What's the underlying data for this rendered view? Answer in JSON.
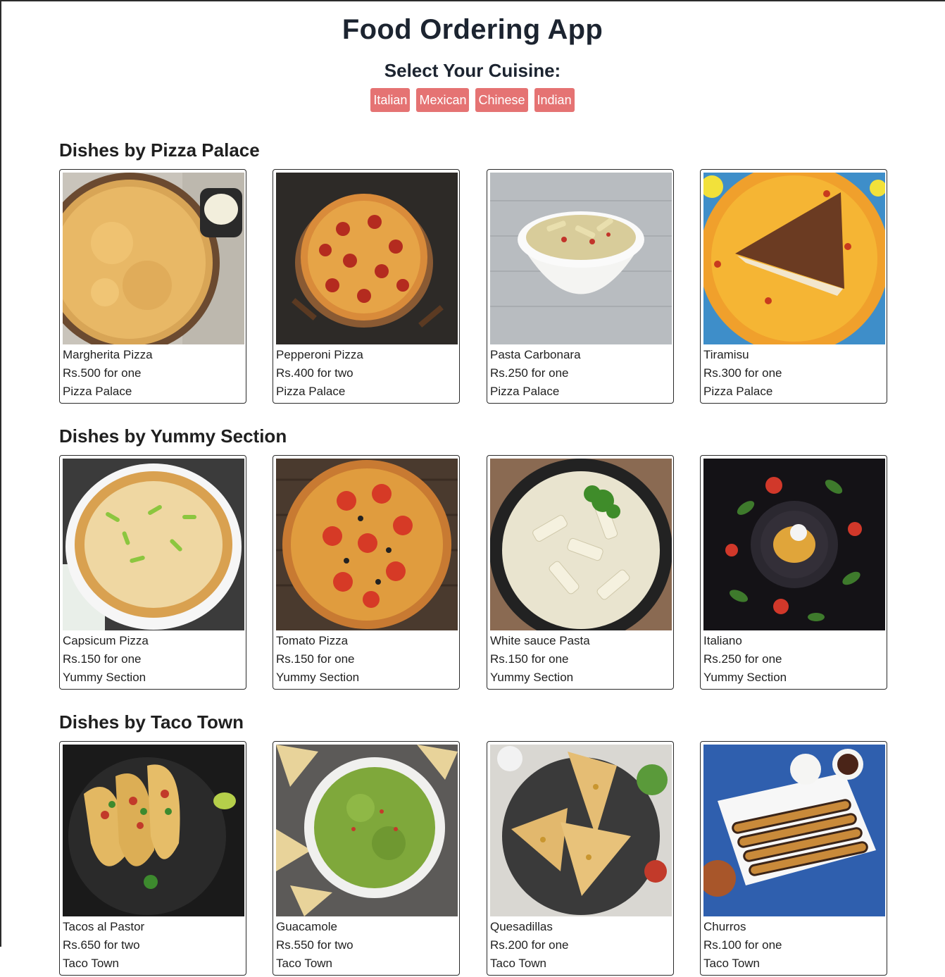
{
  "app": {
    "title": "Food Ordering App",
    "cuisine_prompt": "Select Your Cuisine:"
  },
  "cuisines": [
    "Italian",
    "Mexican",
    "Chinese",
    "Indian"
  ],
  "colors": {
    "cuisine_button": "#e57373",
    "heading": "#1c2430",
    "card_border": "#2a2a2a"
  },
  "sections": [
    {
      "title": "Dishes by Pizza Palace",
      "dishes": [
        {
          "name": "Margherita Pizza",
          "price": "Rs.500 for one",
          "restaurant": "Pizza Palace",
          "image": "cheese-pizza"
        },
        {
          "name": "Pepperoni Pizza",
          "price": "Rs.400 for two",
          "restaurant": "Pizza Palace",
          "image": "pepperoni-pizza"
        },
        {
          "name": "Pasta Carbonara",
          "price": "Rs.250 for one",
          "restaurant": "Pizza Palace",
          "image": "pasta-bowl"
        },
        {
          "name": "Tiramisu",
          "price": "Rs.300 for one",
          "restaurant": "Pizza Palace",
          "image": "tiramisu-slice"
        }
      ]
    },
    {
      "title": "Dishes by Yummy Section",
      "dishes": [
        {
          "name": "Capsicum Pizza",
          "price": "Rs.150 for one",
          "restaurant": "Yummy Section",
          "image": "capsicum-pizza"
        },
        {
          "name": "Tomato Pizza",
          "price": "Rs.150 for one",
          "restaurant": "Yummy Section",
          "image": "tomato-pizza"
        },
        {
          "name": "White sauce Pasta",
          "price": "Rs.150 for one",
          "restaurant": "Yummy Section",
          "image": "white-sauce-pasta"
        },
        {
          "name": "Italiano",
          "price": "Rs.250 for one",
          "restaurant": "Yummy Section",
          "image": "italiano-plate"
        }
      ]
    },
    {
      "title": "Dishes by Taco Town",
      "dishes": [
        {
          "name": "Tacos al Pastor",
          "price": "Rs.650 for two",
          "restaurant": "Taco Town",
          "image": "tacos"
        },
        {
          "name": "Guacamole",
          "price": "Rs.550 for two",
          "restaurant": "Taco Town",
          "image": "guacamole-bowl"
        },
        {
          "name": "Quesadillas",
          "price": "Rs.200 for one",
          "restaurant": "Taco Town",
          "image": "quesadillas"
        },
        {
          "name": "Churros",
          "price": "Rs.100 for one",
          "restaurant": "Taco Town",
          "image": "churros"
        }
      ]
    }
  ]
}
